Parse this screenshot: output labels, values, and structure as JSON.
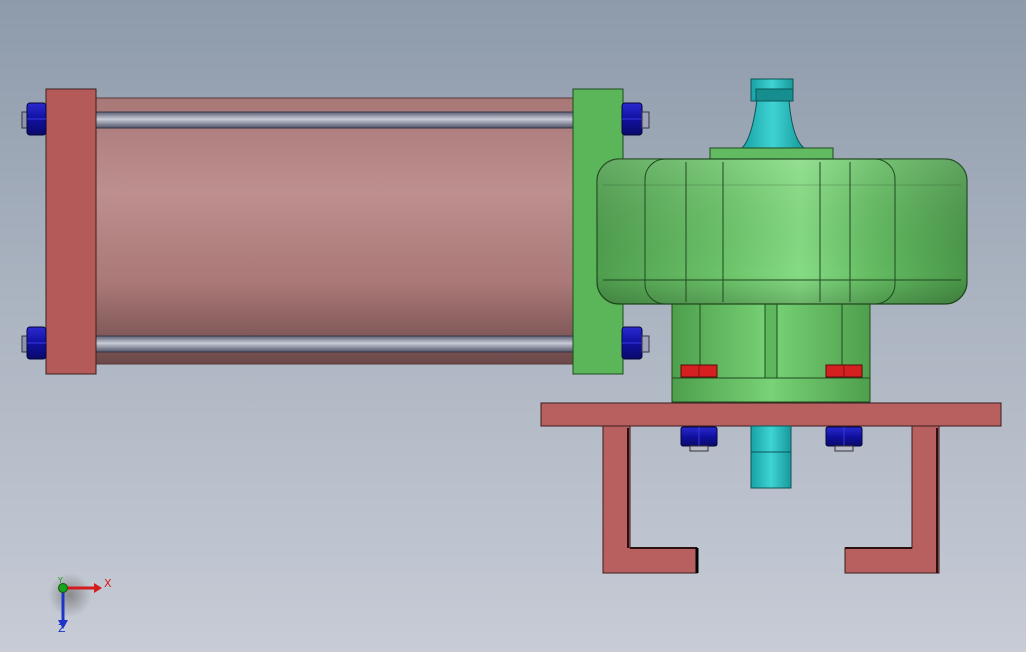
{
  "scene": {
    "background_top": "#8e9bab",
    "background_bottom": "#c7ccd6",
    "colors": {
      "cylinder_body": "#b78887",
      "cylinder_plate": "#b45b59",
      "flange_plate": "#5bb659",
      "housing": "#66c064",
      "shaft": "#1fb8b8",
      "bracket": "#b85f5f",
      "nut_blue": "#1c1cb0",
      "nut_red": "#d42020",
      "tie_rod": "#8f94a8"
    },
    "components": [
      "pneumatic-cylinder",
      "cylinder-end-plate",
      "tie-rod",
      "mounting-flange",
      "actuator-housing",
      "output-shaft",
      "mounting-bracket",
      "hex-nut"
    ]
  },
  "triad": {
    "x_label": "X",
    "y_label": "Y",
    "z_label": "Z",
    "x_color": "#d41c1c",
    "y_color": "#1aa31a",
    "z_color": "#1e34c8"
  }
}
